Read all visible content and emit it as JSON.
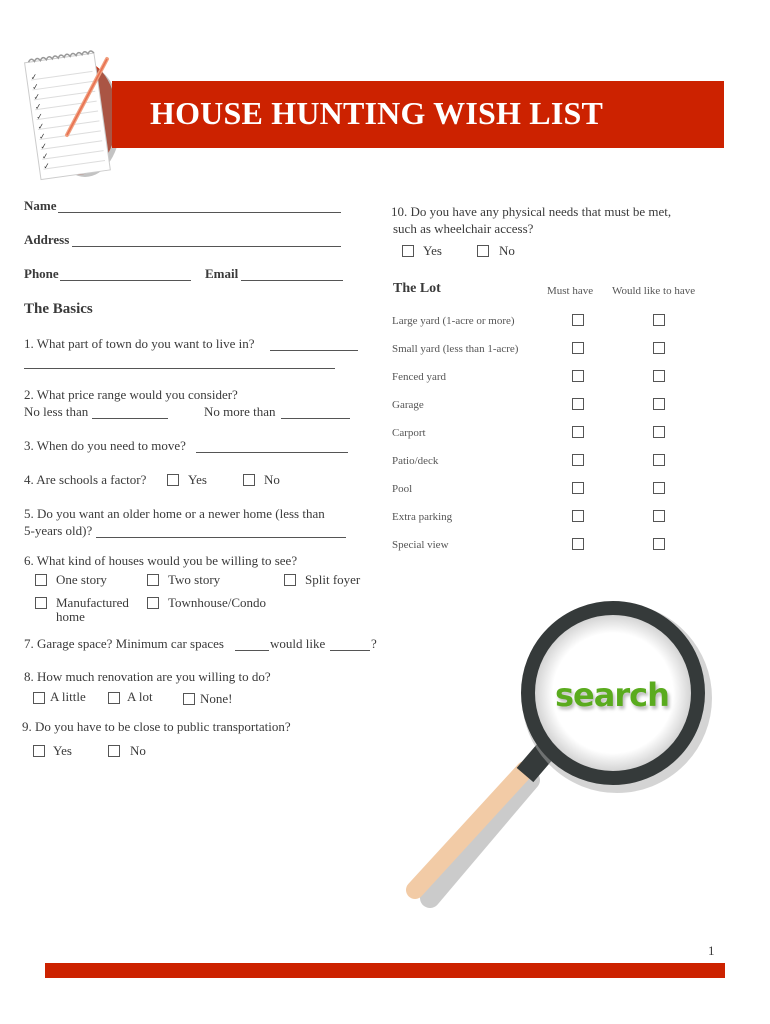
{
  "header": {
    "title": "HOUSE HUNTING WISH LIST",
    "accent_color": "#cc2200",
    "logo_icon": "notepad-checklist-pencil-icon"
  },
  "contact": {
    "name_label": "Name",
    "address_label": "Address",
    "phone_label": "Phone",
    "email_label": "Email"
  },
  "basics": {
    "heading": "The Basics",
    "q1": "1. What part of town do you want to live in?",
    "q2": "2. What price range would you consider?",
    "q2_min": "No less than",
    "q2_max": "No more than",
    "q3": "3. When do you need to move?",
    "q4": "4. Are schools a factor?",
    "q4_options": [
      "Yes",
      "No"
    ],
    "q5_line1": "5. Do you want an older home or a newer home (less than",
    "q5_line2": "5-years old)?",
    "q6": "6. What kind of houses would you be willing to see?",
    "q6_options": [
      "One story",
      "Two story",
      "Split foyer",
      "Manufactured",
      "Townhouse/Condo"
    ],
    "q6_option4_line2": "home",
    "q7_a": "7. Garage space? Minimum car spaces",
    "q7_b": "would like",
    "q7_c": "?",
    "q8": "8. How much renovation are you willing to do?",
    "q8_options": [
      "A little",
      "A lot",
      "None!"
    ],
    "q9": "9. Do you have to be close to public transportation?",
    "q9_options": [
      "Yes",
      "No"
    ]
  },
  "right": {
    "q10_line1": "10. Do you have any physical needs that must be met,",
    "q10_line2": "such as wheelchair access?",
    "q10_options": [
      "Yes",
      "No"
    ],
    "lot_heading": "The Lot",
    "col_must": "Must have",
    "col_would": "Would like to have",
    "lot_items": [
      "Large yard (1-acre or more)",
      "Small yard (less than 1-acre)",
      "Fenced yard",
      "Garage",
      "Carport",
      "Patio/deck",
      "Pool",
      "Extra parking",
      "Special view"
    ]
  },
  "illustration": {
    "icon": "magnifying-glass-icon",
    "text": "search",
    "text_color": "#5aab1e",
    "frame_color": "#353a3a",
    "handle_color": "#f2cba6"
  },
  "footer": {
    "page_number": "1"
  }
}
